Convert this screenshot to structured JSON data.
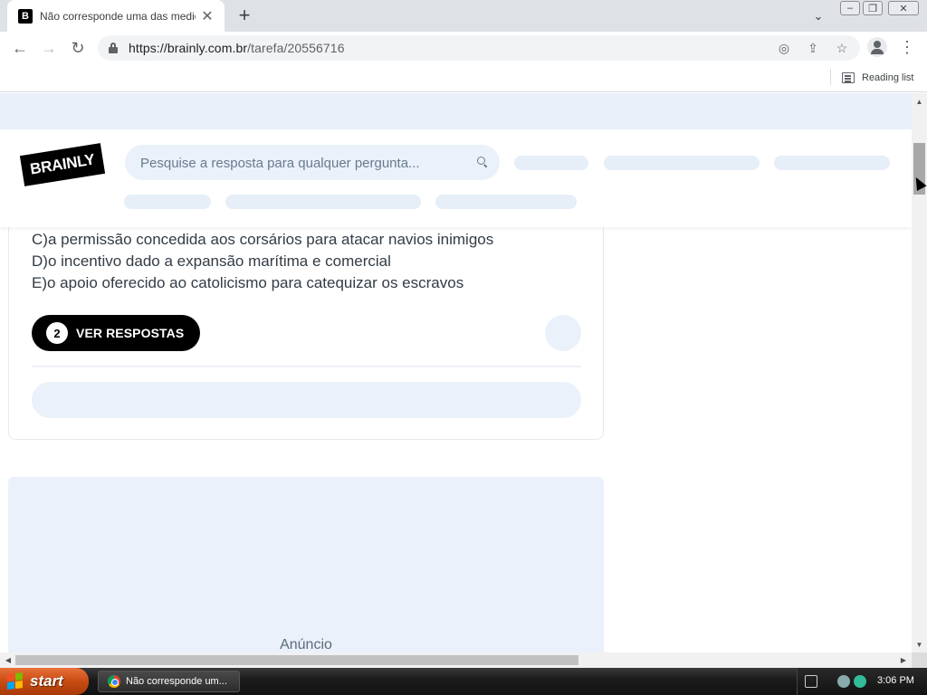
{
  "browser": {
    "tab_title": "Não corresponde uma das medidas",
    "favicon_letter": "B",
    "url_host": "https://brainly.com.br",
    "url_path": "/tarefa/20556716",
    "reading_list_label": "Reading list"
  },
  "site": {
    "logo_text": "BRAINLY",
    "search_placeholder": "Pesquise a resposta para qualquer pergunta..."
  },
  "question": {
    "options": [
      "C)a permissão concedida aos corsários para atacar navios inimigos",
      "D)o incentivo dado a expansão marítima e comercial",
      "E)o apoio oferecido ao catolicismo para catequizar os escravos"
    ],
    "answers_count": "2",
    "answers_button_label": "VER RESPOSTAS"
  },
  "ad": {
    "label": "Anúncio"
  },
  "taskbar": {
    "start_label": "start",
    "task_label": "Não corresponde um...",
    "clock": "3:06 PM"
  },
  "colors": {
    "brand_black": "#000000",
    "skeleton": "#eaf1fb",
    "taskbar_start": "#c84b12"
  }
}
